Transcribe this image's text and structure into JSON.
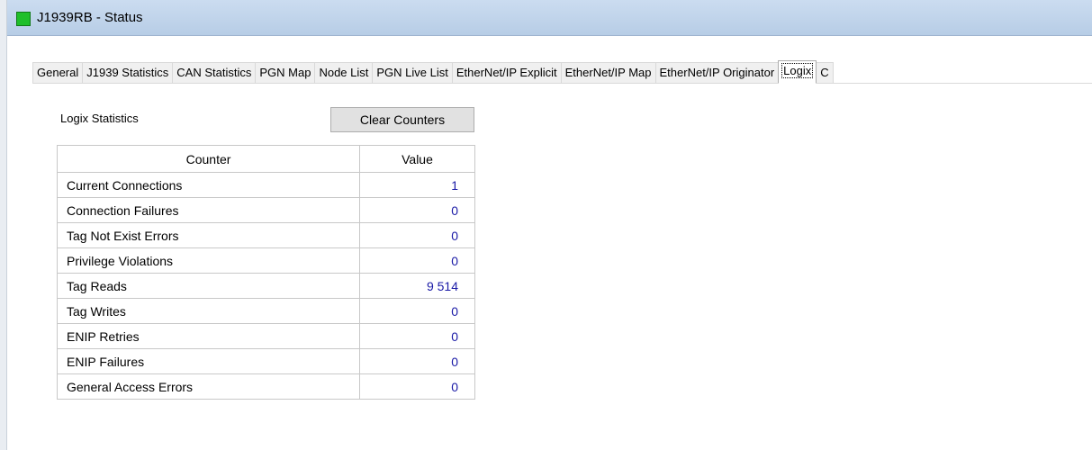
{
  "window": {
    "title": "J1939RB - Status"
  },
  "tabs": [
    {
      "label": "General",
      "active": false
    },
    {
      "label": "J1939 Statistics",
      "active": false
    },
    {
      "label": "CAN Statistics",
      "active": false
    },
    {
      "label": "PGN Map",
      "active": false
    },
    {
      "label": "Node List",
      "active": false
    },
    {
      "label": "PGN Live List",
      "active": false
    },
    {
      "label": "EtherNet/IP Explicit",
      "active": false
    },
    {
      "label": "EtherNet/IP Map",
      "active": false
    },
    {
      "label": "EtherNet/IP Originator",
      "active": false
    },
    {
      "label": "Logix",
      "active": true
    },
    {
      "label": "C",
      "active": false
    }
  ],
  "logix": {
    "section_label": "Logix Statistics",
    "clear_button": "Clear Counters",
    "columns": [
      "Counter",
      "Value"
    ],
    "rows": [
      {
        "counter": "Current Connections",
        "value": "1"
      },
      {
        "counter": "Connection Failures",
        "value": "0"
      },
      {
        "counter": "Tag Not Exist Errors",
        "value": "0"
      },
      {
        "counter": "Privilege Violations",
        "value": "0"
      },
      {
        "counter": "Tag Reads",
        "value": "9 514"
      },
      {
        "counter": "Tag Writes",
        "value": "0"
      },
      {
        "counter": "ENIP Retries",
        "value": "0"
      },
      {
        "counter": "ENIP Failures",
        "value": "0"
      },
      {
        "counter": "General Access Errors",
        "value": "0"
      }
    ]
  },
  "colors": {
    "status_icon": "#1fbf2a",
    "value_text": "#1a1aa6",
    "titlebar": "#bfd3ea"
  },
  "icons": {
    "status": "green-status-square-icon"
  }
}
